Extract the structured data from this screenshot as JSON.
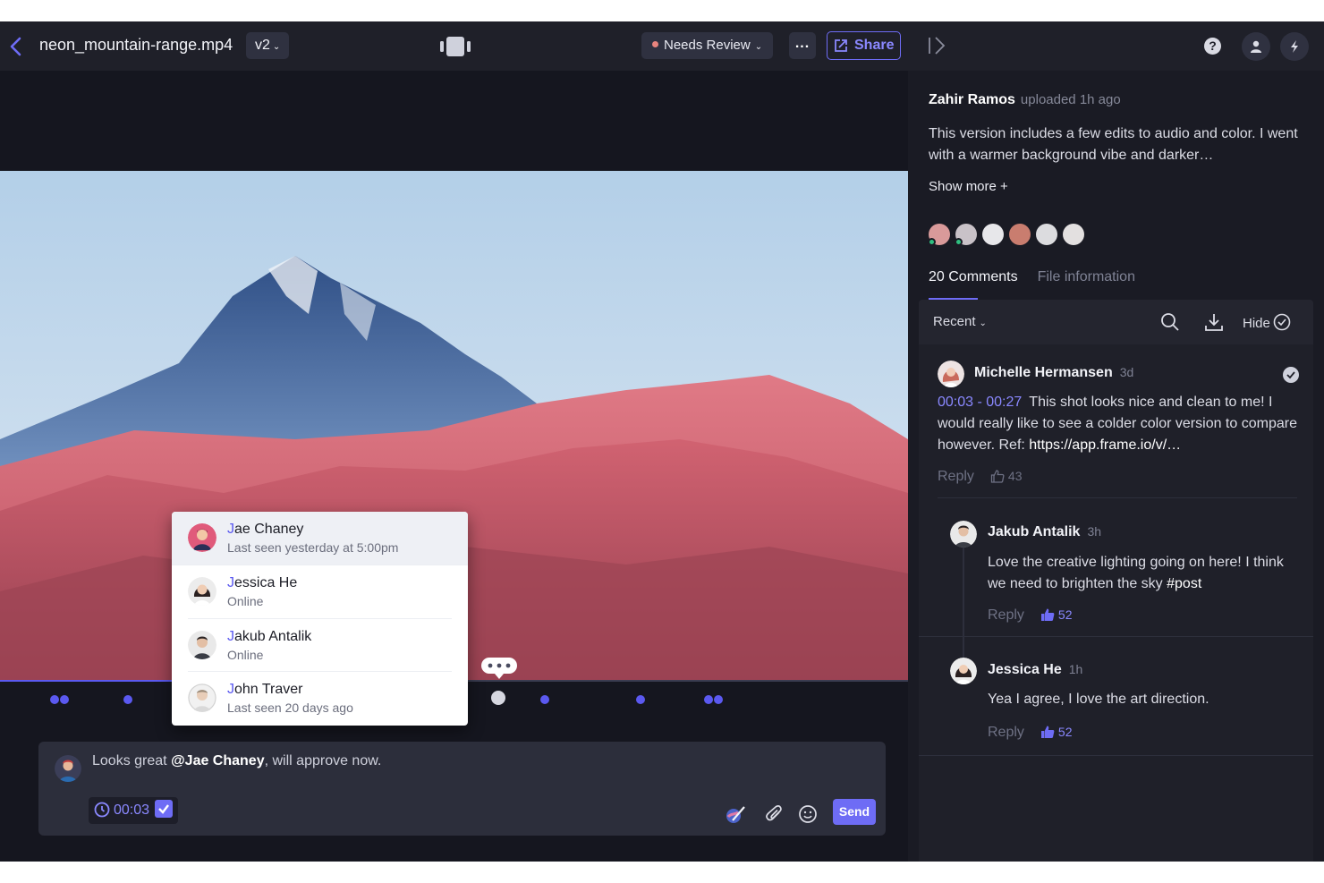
{
  "header": {
    "filename": "neon_mountain-range.mp4",
    "version": "v2",
    "status": "Needs Review",
    "more_label": "...",
    "share_label": "Share",
    "help_label": "?",
    "colors": {
      "accent": "#6e6cf5",
      "status_dot": "#e8847e"
    }
  },
  "player": {
    "markers": [
      {
        "count": 2
      },
      {
        "count": 1
      },
      {
        "count": 1
      },
      {
        "count": 1
      },
      {
        "count": 1
      },
      {
        "count": 2
      }
    ]
  },
  "mentions": [
    {
      "initial": "J",
      "rest": "ae Chaney",
      "status": "Last seen yesterday at 5:00pm"
    },
    {
      "initial": "J",
      "rest": "essica He",
      "status": "Online"
    },
    {
      "initial": "J",
      "rest": "akub Antalik",
      "status": "Online"
    },
    {
      "initial": "J",
      "rest": "ohn Traver",
      "status": "Last seen 20 days ago"
    }
  ],
  "composer": {
    "text_before": "Looks great ",
    "mention": "@Jae Chaney",
    "text_after": ", will approve now.",
    "timecode": "00:03",
    "send_label": "Send"
  },
  "sidebar": {
    "uploader_name": "Zahir Ramos",
    "uploader_meta": "uploaded 1h ago",
    "description": "This version includes a few edits to audio and color. I went with a warmer background vibe and darker…",
    "show_more": "Show more +",
    "tabs": [
      "20 Comments",
      "File information"
    ],
    "sort_label": "Recent",
    "hide_label": "Hide"
  },
  "comments": [
    {
      "author": "Michelle Hermansen",
      "time": "3d",
      "timecode": "00:03 - 00:27",
      "text": "This shot looks nice and clean to me! I would really like to see a colder color version to compare however. Ref: ",
      "link": "https://app.frame.io/v/…",
      "reply_label": "Reply",
      "likes": "43"
    },
    {
      "author": "Jakub Antalik",
      "time": "3h",
      "text": "Love the creative lighting going on here! I think we need to brighten the sky ",
      "tag": "#post",
      "reply_label": "Reply",
      "likes": "52"
    },
    {
      "author": "Jessica He",
      "time": "1h",
      "text": "Yea I agree, I love the art direction.",
      "reply_label": "Reply",
      "likes": "52"
    }
  ]
}
